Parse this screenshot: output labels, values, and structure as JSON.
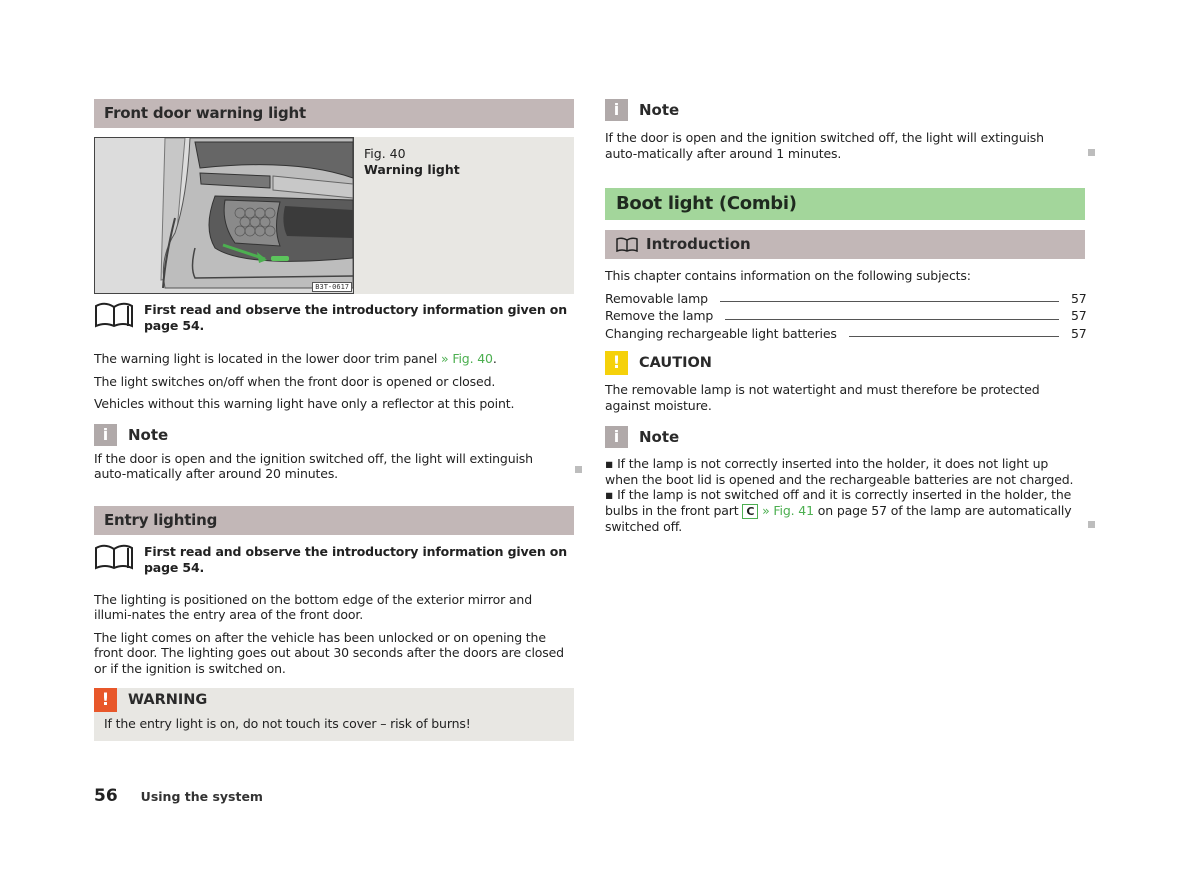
{
  "page": {
    "number": "56",
    "footer_text": "Using the system"
  },
  "left": {
    "section1": {
      "heading": "Front door warning light",
      "figure": {
        "number": "Fig. 40",
        "title": "Warning light",
        "image_code": "B3T-0617"
      },
      "intro_ref": "First read and observe the introductory information given on page 54.",
      "paragraphs": [
        {
          "text": "The warning light is located in the lower door trim panel ",
          "link": "» Fig. 40",
          "tail": "."
        },
        {
          "text": "The light switches on/off when the front door is opened or closed."
        },
        {
          "text": "Vehicles without this warning light have only a reflector at this point."
        }
      ],
      "note": {
        "icon": "info-icon",
        "icon_glyph": "i",
        "title": "Note",
        "text": "If the door is open and the ignition switched off, the light will extinguish auto-matically after around 20 minutes."
      }
    },
    "section2": {
      "heading": "Entry lighting",
      "intro_ref": "First read and observe the introductory information given on page 54.",
      "paragraphs": [
        "The lighting is positioned on the bottom edge of the exterior mirror and illumi-nates the entry area of the front door.",
        "The light comes on after the vehicle has been unlocked or on opening the front door. The lighting goes out about 30 seconds after the doors are closed or if the ignition is switched on."
      ],
      "warning": {
        "icon": "warning-icon",
        "icon_glyph": "!",
        "title": "WARNING",
        "text": "If the entry light is on, do not touch its cover – risk of burns!"
      }
    }
  },
  "right": {
    "note_top": {
      "icon_glyph": "i",
      "title": "Note",
      "text": "If the door is open and the ignition switched off, the light will extinguish auto-matically after around 1 minutes."
    },
    "chapter": {
      "heading": "Boot light (Combi)",
      "intro_heading": "Introduction",
      "intro_text": "This chapter contains information on the following subjects:",
      "toc": [
        {
          "label": "Removable lamp",
          "page": "57"
        },
        {
          "label": "Remove the lamp",
          "page": "57"
        },
        {
          "label": "Changing rechargeable light batteries",
          "page": "57"
        }
      ],
      "caution": {
        "icon_glyph": "!",
        "title": "CAUTION",
        "text": "The removable lamp is not watertight and must therefore be protected against moisture."
      },
      "note": {
        "icon_glyph": "i",
        "title": "Note",
        "bullet1": "▪ If the lamp is not correctly inserted into the holder, it does not light up when the boot lid is opened and the rechargeable batteries are not charged.",
        "bullet2_a": "▪ If the lamp is not switched off and it is correctly inserted in the holder, the bulbs in the front part ",
        "bullet2_part": "C",
        "bullet2_link": "» Fig. 41",
        "bullet2_b": " on page 57 of the lamp are automatically switched off."
      }
    }
  },
  "colors": {
    "section_heading_bg": "#c2b7b7",
    "chapter_heading_bg": "#a3d69b",
    "link_green": "#4caf50",
    "warning_orange": "#e8572a",
    "caution_yellow": "#f5d10a",
    "note_grey": "#b0a9a9",
    "box_bg": "#e8e7e3"
  }
}
